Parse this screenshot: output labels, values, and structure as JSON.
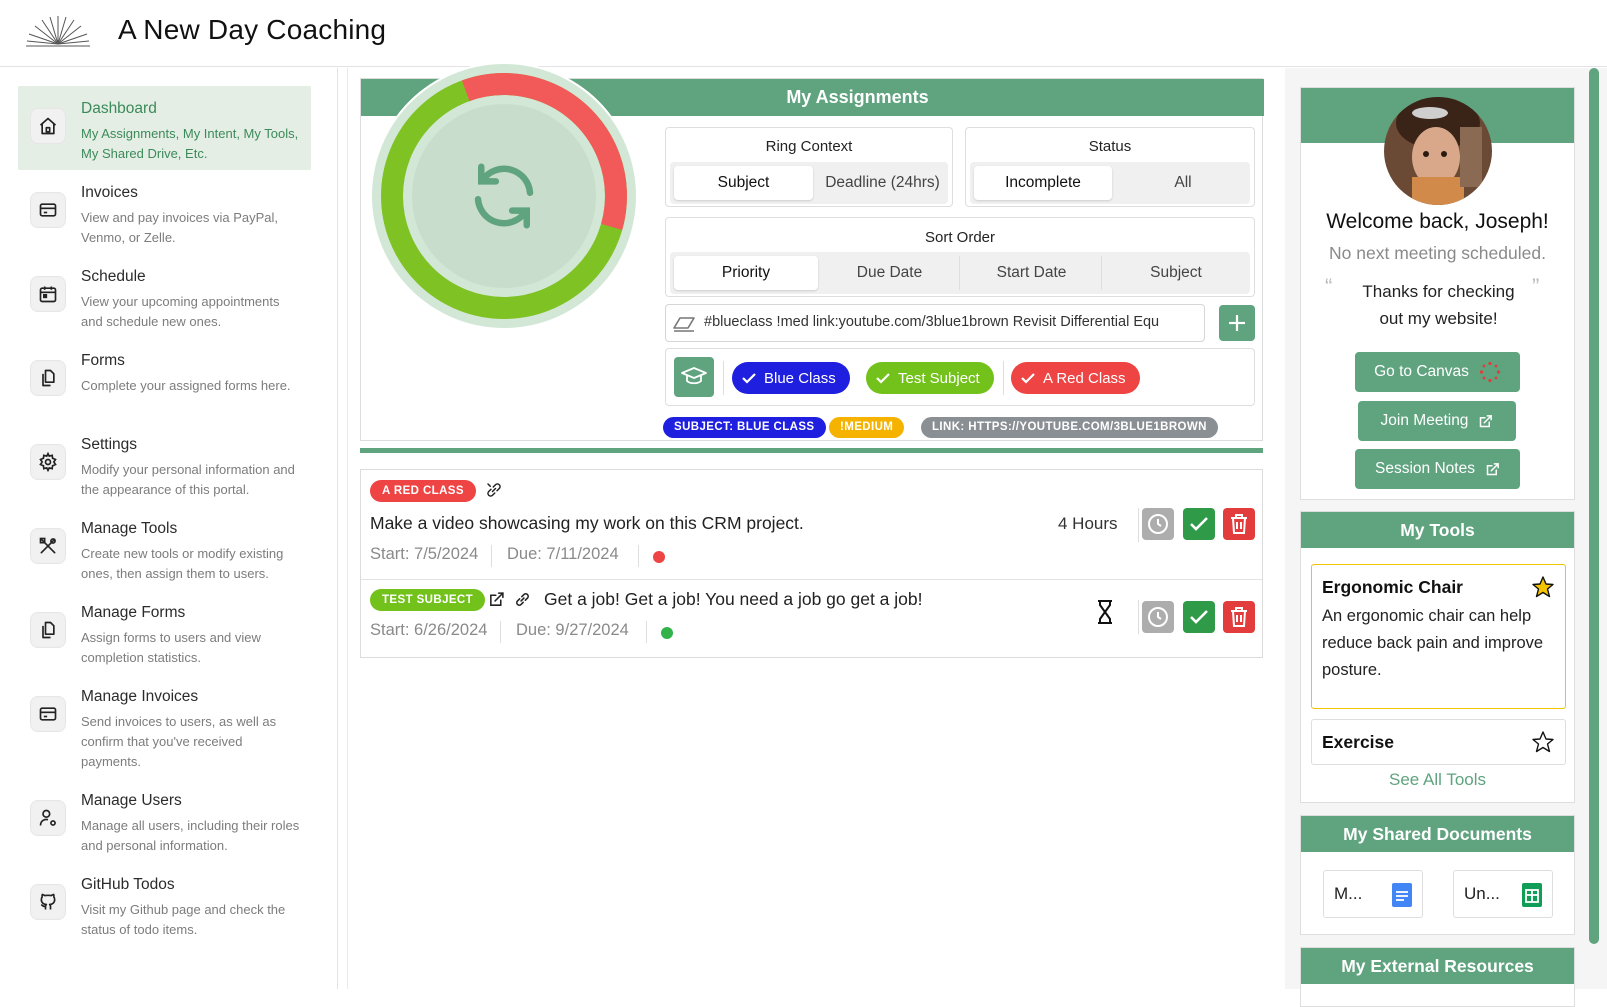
{
  "app": {
    "title": "A New Day Coaching"
  },
  "sidebar": {
    "items": [
      {
        "label": "Dashboard",
        "desc": "My Assignments, My Intent, My Tools, My Shared Drive, Etc.",
        "icon": "home-icon",
        "active": true
      },
      {
        "label": "Invoices",
        "desc": "View and pay invoices via PayPal, Venmo, or Zelle.",
        "icon": "credit-card-icon"
      },
      {
        "label": "Schedule",
        "desc": "View your upcoming appointments and schedule new ones.",
        "icon": "calendar-icon"
      },
      {
        "label": "Forms",
        "desc": "Complete your assigned forms here.",
        "icon": "documents-icon"
      },
      {
        "label": "Settings",
        "desc": "Modify your personal information and the appearance of this portal.",
        "icon": "gear-icon"
      },
      {
        "label": "Manage Tools",
        "desc": "Create new tools or modify existing ones, then assign them to users.",
        "icon": "tools-icon"
      },
      {
        "label": "Manage Forms",
        "desc": "Assign forms to users and view completion statistics.",
        "icon": "documents-icon"
      },
      {
        "label": "Manage Invoices",
        "desc": "Send invoices to users, as well as confirm that you've received payments.",
        "icon": "credit-card-icon"
      },
      {
        "label": "Manage Users",
        "desc": "Manage all users, including their roles and personal information.",
        "icon": "user-gear-icon"
      },
      {
        "label": "GitHub Todos",
        "desc": "Visit my Github page and check the status of todo items.",
        "icon": "github-icon"
      }
    ]
  },
  "assignments": {
    "title": "My Assignments",
    "ring_context": {
      "label": "Ring Context",
      "options": [
        "Subject",
        "Deadline (24hrs)"
      ],
      "selected": "Subject"
    },
    "status": {
      "label": "Status",
      "options": [
        "Incomplete",
        "All"
      ],
      "selected": "Incomplete"
    },
    "sort_order": {
      "label": "Sort Order",
      "options": [
        "Priority",
        "Due Date",
        "Start Date",
        "Subject"
      ],
      "selected": "Priority"
    },
    "command_input": {
      "value": "#blueclass !med link:youtube.com/3blue1brown Revisit Differential Equ"
    },
    "subject_chips": [
      {
        "label": "Blue Class",
        "color": "#1f1fe0"
      },
      {
        "label": "Test Subject",
        "color": "#73c21c"
      },
      {
        "label": "A Red Class",
        "color": "#ee4444"
      }
    ],
    "parsed_tags": [
      {
        "label": "SUBJECT: BLUE CLASS",
        "color": "#1f1fe0"
      },
      {
        "label": "!MEDIUM",
        "color": "#f5b300"
      },
      {
        "label": "LINK: HTTPS://YOUTUBE.COM/3BLUE1BROWN",
        "color": "#8a8f94"
      }
    ],
    "ring": {
      "red_fraction": 0.35,
      "green_fraction": 0.65
    },
    "tasks": [
      {
        "subject": "A RED CLASS",
        "subject_color": "#ee4444",
        "text": "Make a video showcasing my work on this CRM project.",
        "start": "Start: 7/5/2024",
        "due": "Due: 7/11/2024",
        "duration": "4 Hours",
        "dot_color": "#ee4444"
      },
      {
        "subject": "TEST SUBJECT",
        "subject_color": "#73c21c",
        "text": "Get a job! Get a job! You need a job go get a job!",
        "start": "Start: 6/26/2024",
        "due": "Due: 9/27/2024",
        "duration": "",
        "dot_color": "#33b24a"
      }
    ]
  },
  "profile": {
    "welcome": "Welcome back, Joseph!",
    "next_meeting": "No next meeting scheduled.",
    "quote": "Thanks for checking out my website!",
    "buttons": {
      "canvas": "Go to Canvas",
      "join": "Join Meeting",
      "notes": "Session Notes"
    }
  },
  "tools": {
    "title": "My Tools",
    "items": [
      {
        "name": "Ergonomic Chair",
        "desc": "An ergonomic chair can help reduce back pain and improve posture.",
        "favorite": true
      },
      {
        "name": "Exercise",
        "desc": "",
        "favorite": false
      }
    ],
    "see_all": "See All Tools"
  },
  "shared_docs": {
    "title": "My Shared Documents",
    "items": [
      {
        "name": "M...",
        "icon": "google-docs-icon"
      },
      {
        "name": "Un...",
        "icon": "google-sheets-icon"
      }
    ]
  },
  "external": {
    "title": "My External Resources"
  }
}
